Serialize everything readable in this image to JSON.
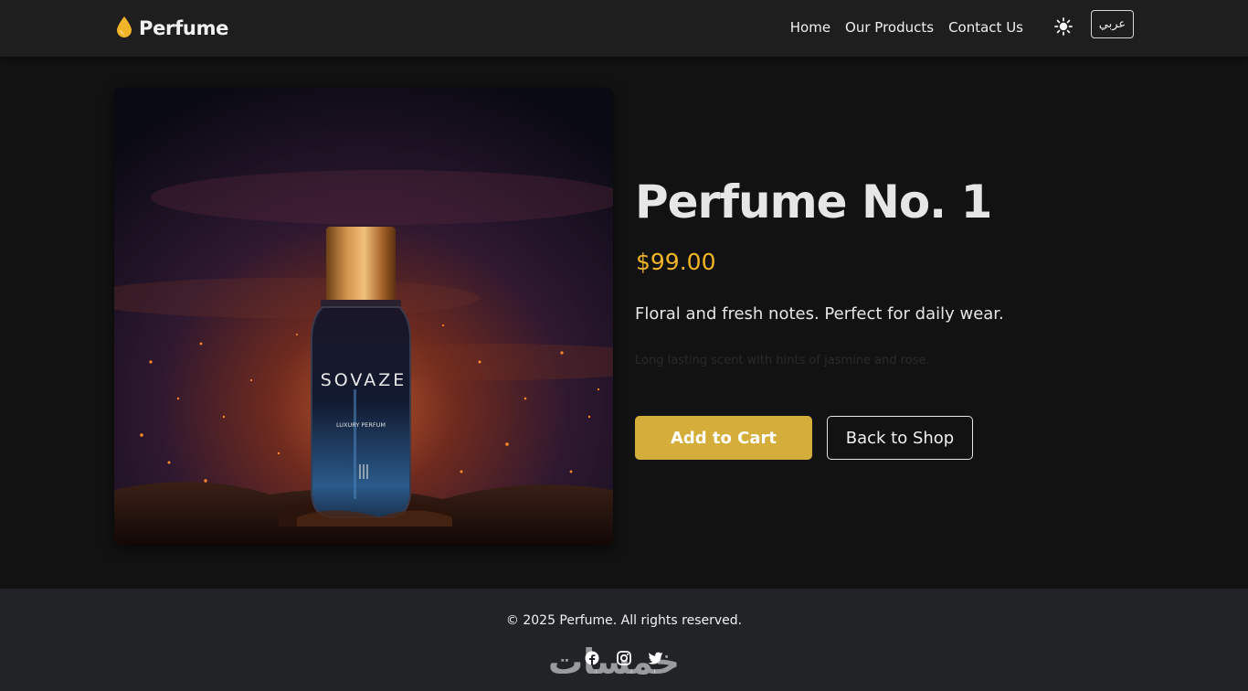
{
  "navbar": {
    "brand": "Perfume",
    "brand_icon": "drop-icon",
    "links": [
      {
        "label": "Home"
      },
      {
        "label": "Our Products"
      },
      {
        "label": "Contact Us"
      }
    ],
    "theme_icon": "sun-icon",
    "lang_label": "عربي"
  },
  "product": {
    "title": "Perfume No. 1",
    "price": "$99.00",
    "description": "Floral and fresh notes. Perfect for daily wear.",
    "extra": "Long lasting scent with hints of jasmine and rose.",
    "image": {
      "bottle_brand": "SOVAZE",
      "bottle_sub": "LUXURY PERFUM"
    },
    "add_to_cart_label": "Add to Cart",
    "back_label": "Back to Shop"
  },
  "footer": {
    "copyright": "© 2025 Perfume. All rights reserved.",
    "socials": [
      "facebook-icon",
      "instagram-icon",
      "twitter-icon"
    ],
    "watermark": "خمسات"
  },
  "colors": {
    "accent": "#f0b429",
    "button": "#d4ad3b",
    "navbar_bg": "#1e1e1e",
    "page_bg": "#121212",
    "footer_bg": "#212327"
  }
}
